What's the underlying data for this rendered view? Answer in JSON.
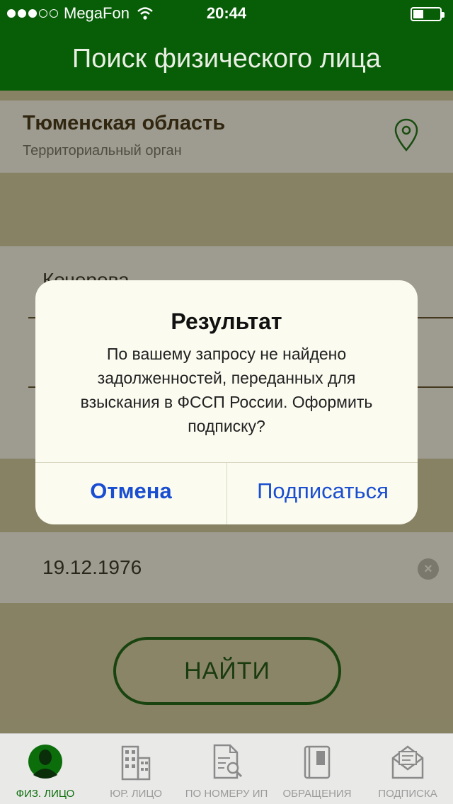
{
  "status_bar": {
    "carrier": "MegaFon",
    "time": "20:44",
    "signal_bars_filled": 3,
    "signal_bars_total": 5
  },
  "nav": {
    "title": "Поиск физического лица"
  },
  "region": {
    "name": "Тюменская область",
    "subtitle": "Территориальный орган"
  },
  "form": {
    "last_name_value": "Кочерова",
    "birth_date_value": "19.12.1976",
    "find_label": "НАЙТИ"
  },
  "alert": {
    "title": "Результат",
    "message": "По вашему запросу не найдено задолженностей, переданных для взыскания в ФССП России. Оформить подписку?",
    "cancel_label": "Отмена",
    "subscribe_label": "Подписаться"
  },
  "tabbar": {
    "tabs": [
      {
        "label": "ФИЗ. ЛИЦО",
        "icon": "person-icon",
        "active": true
      },
      {
        "label": "ЮР. ЛИЦО",
        "icon": "building-icon",
        "active": false
      },
      {
        "label": "ПО НОМЕРУ ИП",
        "icon": "document-search-icon",
        "active": false
      },
      {
        "label": "ОБРАЩЕНИЯ",
        "icon": "book-icon",
        "active": false
      },
      {
        "label": "ПОДПИСКА",
        "icon": "envelope-icon",
        "active": false
      }
    ]
  },
  "colors": {
    "header_green": "#075e07",
    "accent_blue": "#1a4ed1",
    "active_tab_green": "#0b6e0b"
  }
}
